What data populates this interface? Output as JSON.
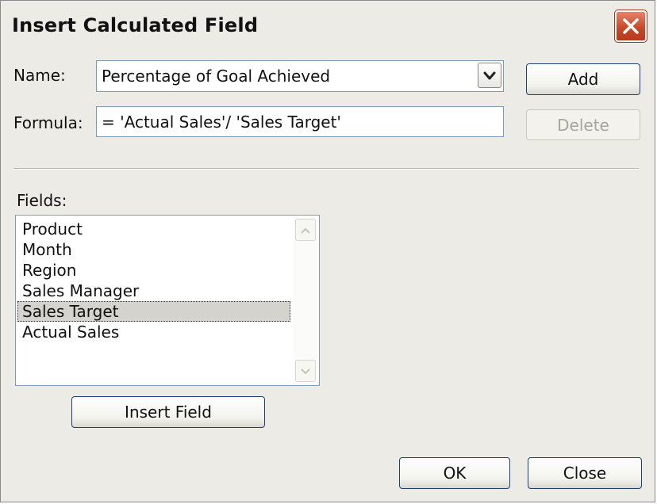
{
  "window": {
    "title": "Insert Calculated Field"
  },
  "form": {
    "name_label": "Name:",
    "name_value": "Percentage of Goal Achieved",
    "formula_label": "Formula:",
    "formula_value": "= 'Actual Sales'/ 'Sales Target'"
  },
  "buttons": {
    "add": "Add",
    "delete": "Delete",
    "insert_field": "Insert Field",
    "ok": "OK",
    "close": "Close"
  },
  "fields": {
    "label": "Fields:",
    "items": [
      "Product",
      "Month",
      "Region",
      "Sales Manager",
      "Sales Target",
      "Actual Sales"
    ],
    "selected": "Sales Target"
  },
  "icons": {
    "window_close": "close-icon",
    "dropdown": "chevron-down-icon",
    "scroll_up": "scroll-up-arrow-icon",
    "scroll_down": "scroll-down-arrow-icon"
  },
  "colors": {
    "dialog_background": "#ecebe6",
    "close_button": "#c84a2b",
    "button_border": "#1c3f7a",
    "selection": "#d4d3cd"
  }
}
